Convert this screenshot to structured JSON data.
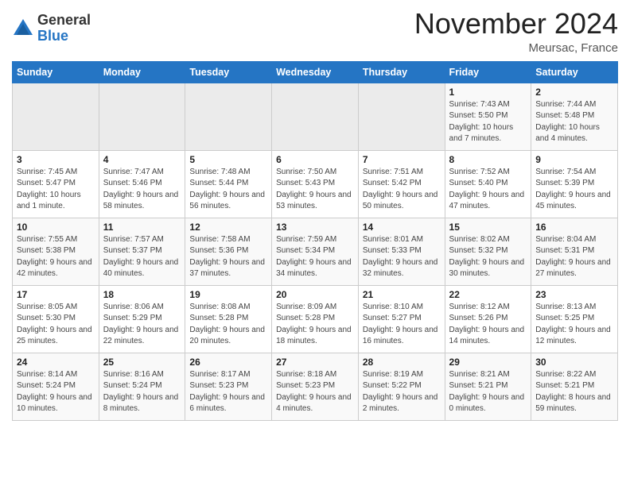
{
  "logo": {
    "general": "General",
    "blue": "Blue"
  },
  "header": {
    "month": "November 2024",
    "location": "Meursac, France"
  },
  "weekdays": [
    "Sunday",
    "Monday",
    "Tuesday",
    "Wednesday",
    "Thursday",
    "Friday",
    "Saturday"
  ],
  "weeks": [
    [
      {
        "day": "",
        "info": ""
      },
      {
        "day": "",
        "info": ""
      },
      {
        "day": "",
        "info": ""
      },
      {
        "day": "",
        "info": ""
      },
      {
        "day": "",
        "info": ""
      },
      {
        "day": "1",
        "info": "Sunrise: 7:43 AM\nSunset: 5:50 PM\nDaylight: 10 hours and 7 minutes."
      },
      {
        "day": "2",
        "info": "Sunrise: 7:44 AM\nSunset: 5:48 PM\nDaylight: 10 hours and 4 minutes."
      }
    ],
    [
      {
        "day": "3",
        "info": "Sunrise: 7:45 AM\nSunset: 5:47 PM\nDaylight: 10 hours and 1 minute."
      },
      {
        "day": "4",
        "info": "Sunrise: 7:47 AM\nSunset: 5:46 PM\nDaylight: 9 hours and 58 minutes."
      },
      {
        "day": "5",
        "info": "Sunrise: 7:48 AM\nSunset: 5:44 PM\nDaylight: 9 hours and 56 minutes."
      },
      {
        "day": "6",
        "info": "Sunrise: 7:50 AM\nSunset: 5:43 PM\nDaylight: 9 hours and 53 minutes."
      },
      {
        "day": "7",
        "info": "Sunrise: 7:51 AM\nSunset: 5:42 PM\nDaylight: 9 hours and 50 minutes."
      },
      {
        "day": "8",
        "info": "Sunrise: 7:52 AM\nSunset: 5:40 PM\nDaylight: 9 hours and 47 minutes."
      },
      {
        "day": "9",
        "info": "Sunrise: 7:54 AM\nSunset: 5:39 PM\nDaylight: 9 hours and 45 minutes."
      }
    ],
    [
      {
        "day": "10",
        "info": "Sunrise: 7:55 AM\nSunset: 5:38 PM\nDaylight: 9 hours and 42 minutes."
      },
      {
        "day": "11",
        "info": "Sunrise: 7:57 AM\nSunset: 5:37 PM\nDaylight: 9 hours and 40 minutes."
      },
      {
        "day": "12",
        "info": "Sunrise: 7:58 AM\nSunset: 5:36 PM\nDaylight: 9 hours and 37 minutes."
      },
      {
        "day": "13",
        "info": "Sunrise: 7:59 AM\nSunset: 5:34 PM\nDaylight: 9 hours and 34 minutes."
      },
      {
        "day": "14",
        "info": "Sunrise: 8:01 AM\nSunset: 5:33 PM\nDaylight: 9 hours and 32 minutes."
      },
      {
        "day": "15",
        "info": "Sunrise: 8:02 AM\nSunset: 5:32 PM\nDaylight: 9 hours and 30 minutes."
      },
      {
        "day": "16",
        "info": "Sunrise: 8:04 AM\nSunset: 5:31 PM\nDaylight: 9 hours and 27 minutes."
      }
    ],
    [
      {
        "day": "17",
        "info": "Sunrise: 8:05 AM\nSunset: 5:30 PM\nDaylight: 9 hours and 25 minutes."
      },
      {
        "day": "18",
        "info": "Sunrise: 8:06 AM\nSunset: 5:29 PM\nDaylight: 9 hours and 22 minutes."
      },
      {
        "day": "19",
        "info": "Sunrise: 8:08 AM\nSunset: 5:28 PM\nDaylight: 9 hours and 20 minutes."
      },
      {
        "day": "20",
        "info": "Sunrise: 8:09 AM\nSunset: 5:28 PM\nDaylight: 9 hours and 18 minutes."
      },
      {
        "day": "21",
        "info": "Sunrise: 8:10 AM\nSunset: 5:27 PM\nDaylight: 9 hours and 16 minutes."
      },
      {
        "day": "22",
        "info": "Sunrise: 8:12 AM\nSunset: 5:26 PM\nDaylight: 9 hours and 14 minutes."
      },
      {
        "day": "23",
        "info": "Sunrise: 8:13 AM\nSunset: 5:25 PM\nDaylight: 9 hours and 12 minutes."
      }
    ],
    [
      {
        "day": "24",
        "info": "Sunrise: 8:14 AM\nSunset: 5:24 PM\nDaylight: 9 hours and 10 minutes."
      },
      {
        "day": "25",
        "info": "Sunrise: 8:16 AM\nSunset: 5:24 PM\nDaylight: 9 hours and 8 minutes."
      },
      {
        "day": "26",
        "info": "Sunrise: 8:17 AM\nSunset: 5:23 PM\nDaylight: 9 hours and 6 minutes."
      },
      {
        "day": "27",
        "info": "Sunrise: 8:18 AM\nSunset: 5:23 PM\nDaylight: 9 hours and 4 minutes."
      },
      {
        "day": "28",
        "info": "Sunrise: 8:19 AM\nSunset: 5:22 PM\nDaylight: 9 hours and 2 minutes."
      },
      {
        "day": "29",
        "info": "Sunrise: 8:21 AM\nSunset: 5:21 PM\nDaylight: 9 hours and 0 minutes."
      },
      {
        "day": "30",
        "info": "Sunrise: 8:22 AM\nSunset: 5:21 PM\nDaylight: 8 hours and 59 minutes."
      }
    ]
  ]
}
